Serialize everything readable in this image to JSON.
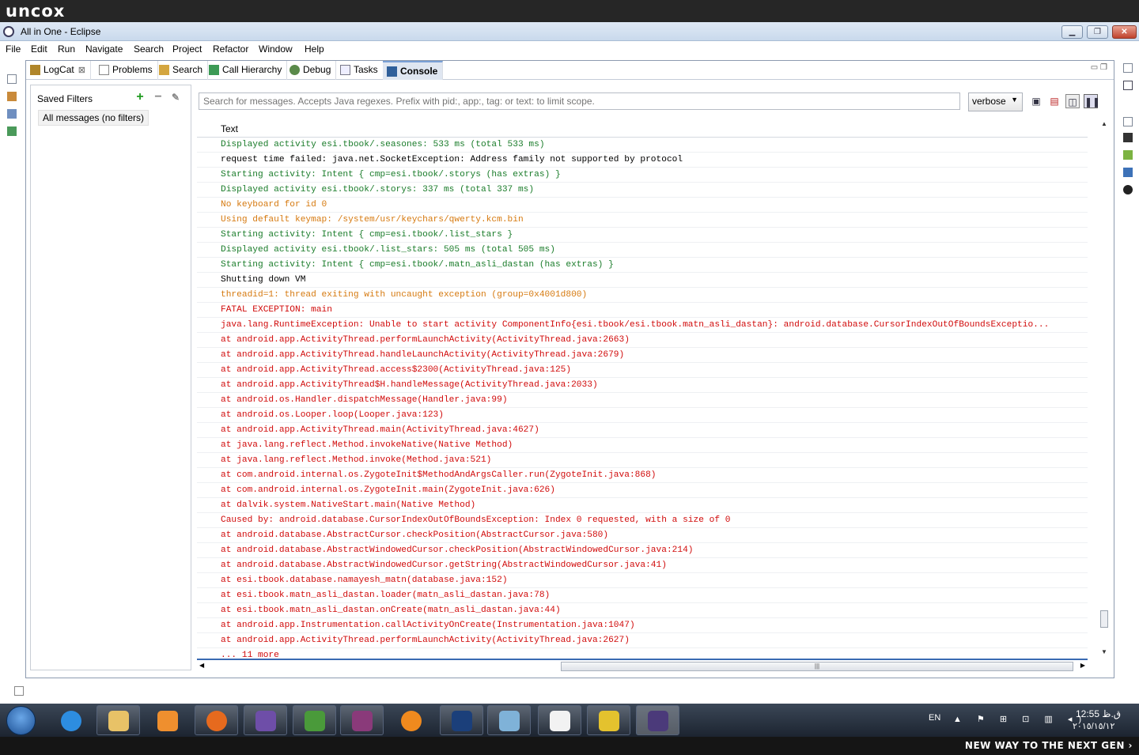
{
  "banner": {
    "brand": "uncox"
  },
  "window": {
    "title": "All in One - Eclipse"
  },
  "menu": [
    "File",
    "Edit",
    "Run",
    "Navigate",
    "Search",
    "Project",
    "Refactor",
    "Window",
    "Help"
  ],
  "tabs": [
    {
      "label": "LogCat",
      "icon": "logcat-icon",
      "active": false,
      "closable": true
    },
    {
      "label": "Problems",
      "icon": "problems-icon",
      "active": false
    },
    {
      "label": "Search",
      "icon": "search-icon",
      "active": false
    },
    {
      "label": "Call Hierarchy",
      "icon": "call-hierarchy-icon",
      "active": false
    },
    {
      "label": "Debug",
      "icon": "debug-icon",
      "active": false
    },
    {
      "label": "Tasks",
      "icon": "tasks-icon",
      "active": false
    },
    {
      "label": "Console",
      "icon": "console-icon",
      "active": true
    }
  ],
  "filters": {
    "title": "Saved Filters",
    "item": "All messages (no filters)"
  },
  "log": {
    "search_placeholder": "Search for messages. Accepts Java regexes. Prefix with pid:, app:, tag: or text: to limit scope.",
    "level": "verbose",
    "column": "Text",
    "rows": [
      {
        "lv": "I",
        "t": "Displayed activity esi.tbook/.seasones: 533 ms (total 533 ms)"
      },
      {
        "lv": "V",
        "t": "request time failed: java.net.SocketException: Address family not supported by protocol"
      },
      {
        "lv": "I",
        "t": "Starting activity: Intent { cmp=esi.tbook/.storys (has extras) }"
      },
      {
        "lv": "I",
        "t": "Displayed activity esi.tbook/.storys: 337 ms (total 337 ms)"
      },
      {
        "lv": "W",
        "t": "No keyboard for id 0"
      },
      {
        "lv": "W",
        "t": "Using default keymap: /system/usr/keychars/qwerty.kcm.bin"
      },
      {
        "lv": "I",
        "t": "Starting activity: Intent { cmp=esi.tbook/.list_stars }"
      },
      {
        "lv": "I",
        "t": "Displayed activity esi.tbook/.list_stars: 505 ms (total 505 ms)"
      },
      {
        "lv": "I",
        "t": "Starting activity: Intent { cmp=esi.tbook/.matn_asli_dastan (has extras) }"
      },
      {
        "lv": "V",
        "t": "Shutting down VM"
      },
      {
        "lv": "W",
        "t": "threadid=1: thread exiting with uncaught exception (group=0x4001d800)"
      },
      {
        "lv": "E",
        "t": "FATAL EXCEPTION: main"
      },
      {
        "lv": "E",
        "t": "java.lang.RuntimeException: Unable to start activity ComponentInfo{esi.tbook/esi.tbook.matn_asli_dastan}: android.database.CursorIndexOutOfBoundsExceptio..."
      },
      {
        "lv": "E",
        "t": "at android.app.ActivityThread.performLaunchActivity(ActivityThread.java:2663)"
      },
      {
        "lv": "E",
        "t": "at android.app.ActivityThread.handleLaunchActivity(ActivityThread.java:2679)"
      },
      {
        "lv": "E",
        "t": "at android.app.ActivityThread.access$2300(ActivityThread.java:125)"
      },
      {
        "lv": "E",
        "t": "at android.app.ActivityThread$H.handleMessage(ActivityThread.java:2033)"
      },
      {
        "lv": "E",
        "t": "at android.os.Handler.dispatchMessage(Handler.java:99)"
      },
      {
        "lv": "E",
        "t": "at android.os.Looper.loop(Looper.java:123)"
      },
      {
        "lv": "E",
        "t": "at android.app.ActivityThread.main(ActivityThread.java:4627)"
      },
      {
        "lv": "E",
        "t": "at java.lang.reflect.Method.invokeNative(Native Method)"
      },
      {
        "lv": "E",
        "t": "at java.lang.reflect.Method.invoke(Method.java:521)"
      },
      {
        "lv": "E",
        "t": "at com.android.internal.os.ZygoteInit$MethodAndArgsCaller.run(ZygoteInit.java:868)"
      },
      {
        "lv": "E",
        "t": "at com.android.internal.os.ZygoteInit.main(ZygoteInit.java:626)"
      },
      {
        "lv": "E",
        "t": "at dalvik.system.NativeStart.main(Native Method)"
      },
      {
        "lv": "E",
        "t": "Caused by: android.database.CursorIndexOutOfBoundsException: Index 0 requested, with a size of 0"
      },
      {
        "lv": "E",
        "t": "at android.database.AbstractCursor.checkPosition(AbstractCursor.java:580)"
      },
      {
        "lv": "E",
        "t": "at android.database.AbstractWindowedCursor.checkPosition(AbstractWindowedCursor.java:214)"
      },
      {
        "lv": "E",
        "t": "at android.database.AbstractWindowedCursor.getString(AbstractWindowedCursor.java:41)"
      },
      {
        "lv": "E",
        "t": "at esi.tbook.database.namayesh_matn(database.java:152)"
      },
      {
        "lv": "E",
        "t": "at esi.tbook.matn_asli_dastan.loader(matn_asli_dastan.java:78)"
      },
      {
        "lv": "E",
        "t": "at esi.tbook.matn_asli_dastan.onCreate(matn_asli_dastan.java:44)"
      },
      {
        "lv": "E",
        "t": "at android.app.Instrumentation.callActivityOnCreate(Instrumentation.java:1047)"
      },
      {
        "lv": "E",
        "t": "at android.app.ActivityThread.performLaunchActivity(ActivityThread.java:2627)"
      },
      {
        "lv": "E",
        "t": "... 11 more"
      }
    ]
  },
  "colors": {
    "verbose": "#000000",
    "info": "#1a7c2a",
    "warn": "#d67a10",
    "error": "#d10b0b"
  },
  "tray": {
    "lang": "EN",
    "time": "12:55 ق.ظ",
    "date": "٢٠١٥/١٥/١٢"
  },
  "footer": {
    "tagline": "NEW WAY TO THE NEXT GEN ›"
  }
}
